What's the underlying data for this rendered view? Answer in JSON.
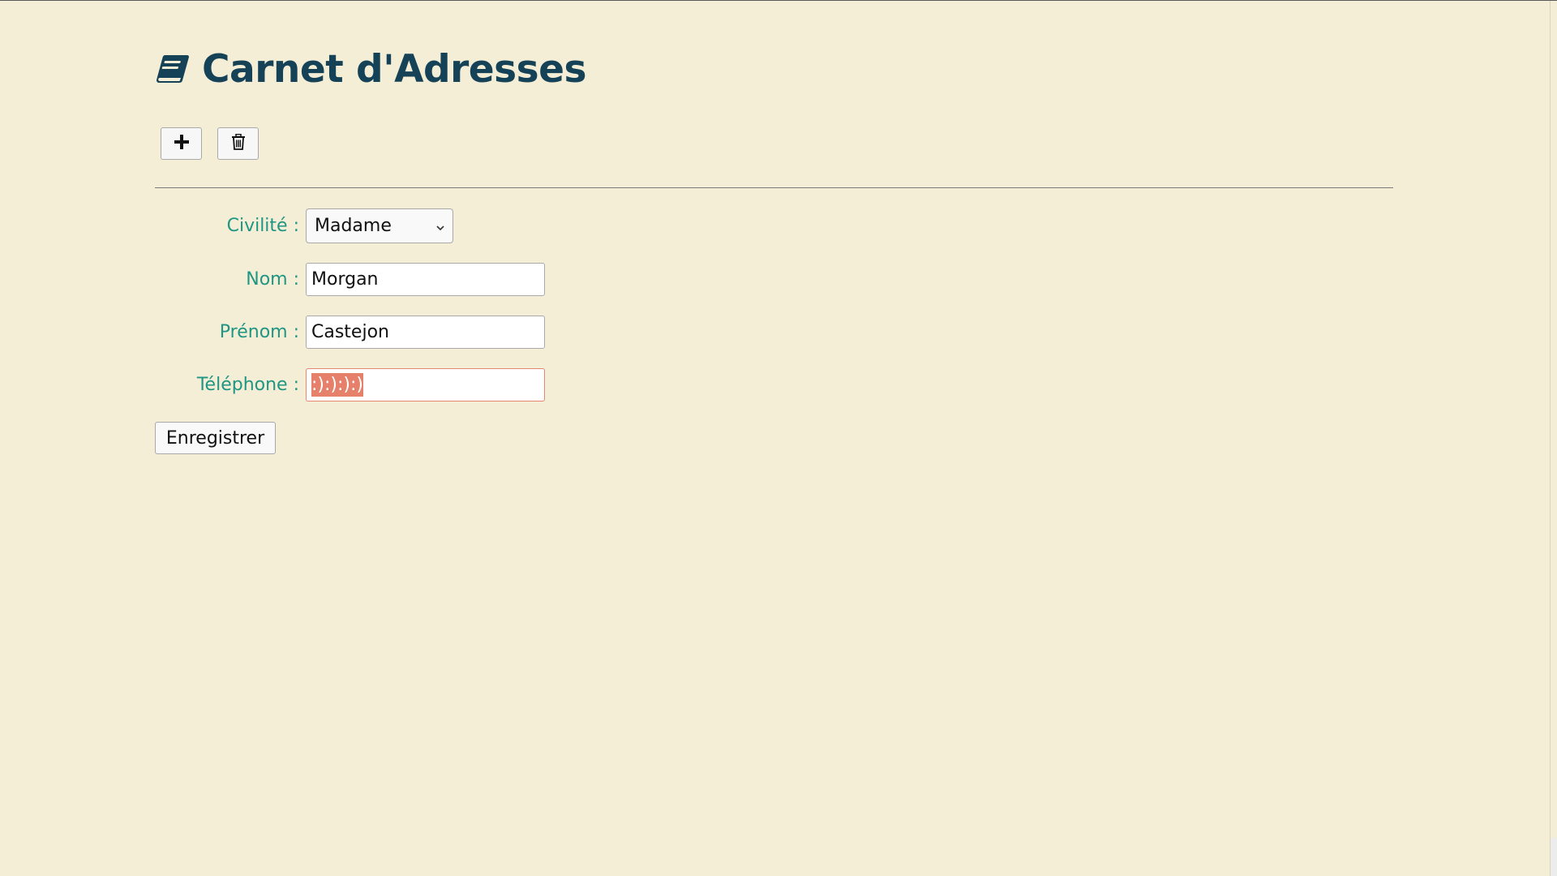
{
  "app": {
    "title": "Carnet d'Adresses",
    "title_color": "#164258",
    "background": "#f4eed6"
  },
  "toolbar": {
    "add_icon": "plus-icon",
    "delete_icon": "trash-icon"
  },
  "form": {
    "civilite": {
      "label": "Civilité :",
      "value": "Madame"
    },
    "nom": {
      "label": "Nom :",
      "value": "Morgan"
    },
    "prenom": {
      "label": "Prénom :",
      "value": "Castejon"
    },
    "telephone": {
      "label": "Téléphone :",
      "value": ":):):):)",
      "state": "invalid"
    },
    "label_color": "#1e9683",
    "invalid_border_color": "#e5866f",
    "selection_color": "#e6806a"
  },
  "actions": {
    "save_label": "Enregistrer"
  }
}
